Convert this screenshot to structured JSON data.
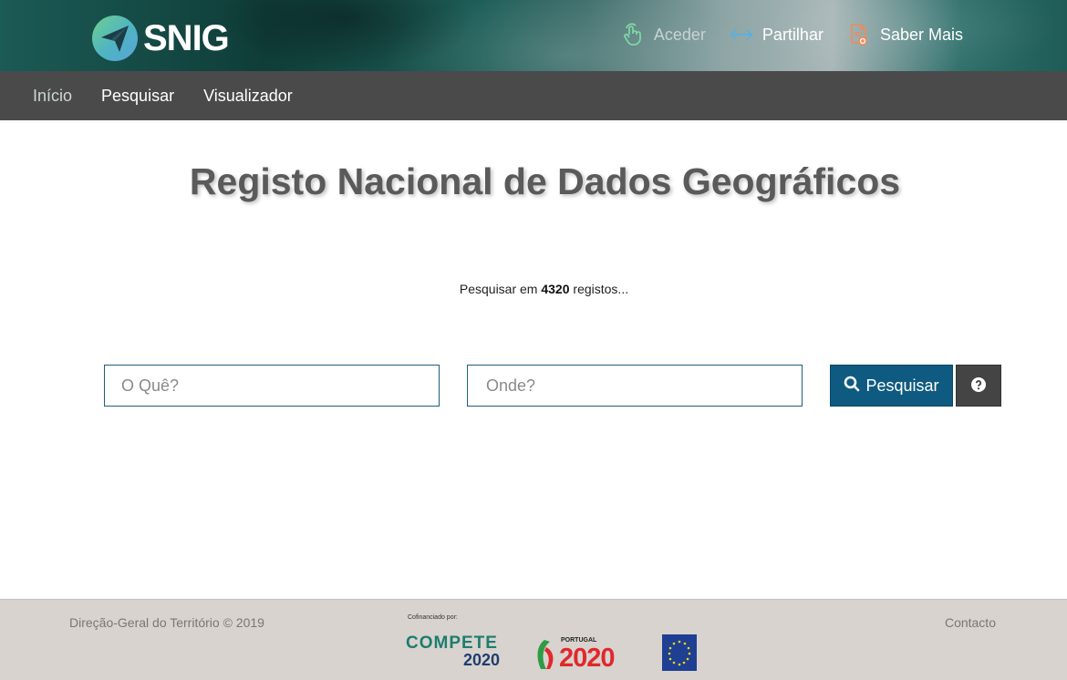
{
  "header": {
    "logo_text": "SNIG",
    "nav": [
      {
        "label": "Aceder",
        "icon": "hand-touch-icon"
      },
      {
        "label": "Partilhar",
        "icon": "share-arrows-icon"
      },
      {
        "label": "Saber Mais",
        "icon": "document-plus-icon"
      }
    ]
  },
  "mainnav": {
    "items": [
      {
        "label": "Início",
        "active": true
      },
      {
        "label": "Pesquisar",
        "active": false
      },
      {
        "label": "Visualizador",
        "active": false
      }
    ]
  },
  "main": {
    "title": "Registo Nacional de Dados Geográficos",
    "subtitle_prefix": "Pesquisar em",
    "record_count": "4320",
    "subtitle_suffix": "registos...",
    "what_placeholder": "O Quê?",
    "where_placeholder": "Onde?",
    "search_label": "Pesquisar",
    "help_icon": "question-circle-icon"
  },
  "footer": {
    "copyright": "Direção-Geral do Território © 2019",
    "contact": "Contacto",
    "cofinanced": "Cofinanciado por:",
    "compete_top": "COMPETE",
    "compete_bottom": "2020",
    "portugal_label": "PORTUGAL",
    "portugal_year": "2020"
  },
  "colors": {
    "nav_bg": "#4a4a4a",
    "primary_button": "#0f5a80",
    "help_button": "#444444",
    "footer_bg": "#d8d3ce",
    "title": "#5a5a5a"
  }
}
